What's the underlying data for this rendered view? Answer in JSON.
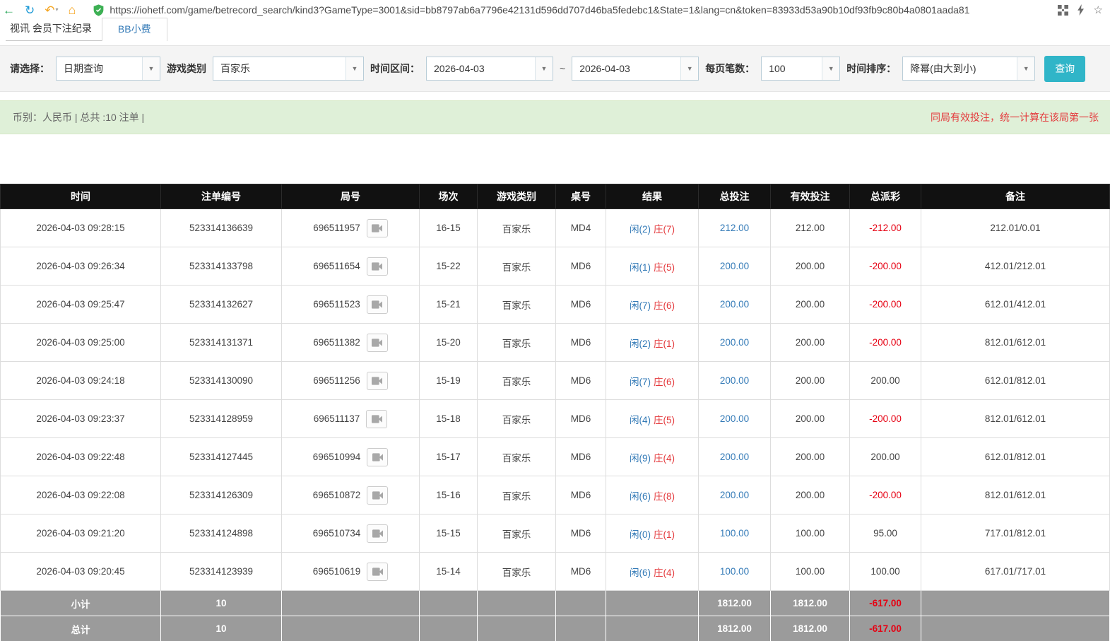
{
  "browser": {
    "url": "https://iohetf.com/game/betrecord_search/kind3?GameType=3001&sid=bb8797ab6a7796e42131d596dd707d46ba5fedebc1&State=1&lang=cn&token=83933d53a90b10df93fb9c80b4a0801aada81"
  },
  "tabs": {
    "records": "视讯 会员下注纪录",
    "bb_tip": "BB小费"
  },
  "filters": {
    "select_label": "请选择：",
    "select_value": "日期查询",
    "game_type_label": "游戏类别",
    "game_type_value": "百家乐",
    "time_range_label": "时间区间：",
    "date_from": "2026-04-03",
    "date_separator": "~",
    "date_to": "2026-04-03",
    "page_size_label": "每页笔数：",
    "page_size_value": "100",
    "sort_label": "时间排序：",
    "sort_value": "降幂(由大到小)",
    "search_button": "查询"
  },
  "info_bar": {
    "summary": "币别：人民币 | 总共 :10 注单 |",
    "notice": "同局有效投注，统一计算在该局第一张"
  },
  "table": {
    "headers": [
      "时间",
      "注单编号",
      "局号",
      "场次",
      "游戏类别",
      "桌号",
      "结果",
      "总投注",
      "有效投注",
      "总派彩",
      "备注"
    ],
    "rows": [
      {
        "time": "2026-04-03 09:28:15",
        "bet_id": "523314136639",
        "round": "696511957",
        "session": "16-15",
        "game": "百家乐",
        "table": "MD4",
        "player": "闲(2)",
        "banker": "庄(7)",
        "total_bet": "212.00",
        "valid_bet": "212.00",
        "payout": "-212.00",
        "remark": "212.01/0.01"
      },
      {
        "time": "2026-04-03 09:26:34",
        "bet_id": "523314133798",
        "round": "696511654",
        "session": "15-22",
        "game": "百家乐",
        "table": "MD6",
        "player": "闲(1)",
        "banker": "庄(5)",
        "total_bet": "200.00",
        "valid_bet": "200.00",
        "payout": "-200.00",
        "remark": "412.01/212.01"
      },
      {
        "time": "2026-04-03 09:25:47",
        "bet_id": "523314132627",
        "round": "696511523",
        "session": "15-21",
        "game": "百家乐",
        "table": "MD6",
        "player": "闲(7)",
        "banker": "庄(6)",
        "total_bet": "200.00",
        "valid_bet": "200.00",
        "payout": "-200.00",
        "remark": "612.01/412.01"
      },
      {
        "time": "2026-04-03 09:25:00",
        "bet_id": "523314131371",
        "round": "696511382",
        "session": "15-20",
        "game": "百家乐",
        "table": "MD6",
        "player": "闲(2)",
        "banker": "庄(1)",
        "total_bet": "200.00",
        "valid_bet": "200.00",
        "payout": "-200.00",
        "remark": "812.01/612.01"
      },
      {
        "time": "2026-04-03 09:24:18",
        "bet_id": "523314130090",
        "round": "696511256",
        "session": "15-19",
        "game": "百家乐",
        "table": "MD6",
        "player": "闲(7)",
        "banker": "庄(6)",
        "total_bet": "200.00",
        "valid_bet": "200.00",
        "payout": "200.00",
        "remark": "612.01/812.01"
      },
      {
        "time": "2026-04-03 09:23:37",
        "bet_id": "523314128959",
        "round": "696511137",
        "session": "15-18",
        "game": "百家乐",
        "table": "MD6",
        "player": "闲(4)",
        "banker": "庄(5)",
        "total_bet": "200.00",
        "valid_bet": "200.00",
        "payout": "-200.00",
        "remark": "812.01/612.01"
      },
      {
        "time": "2026-04-03 09:22:48",
        "bet_id": "523314127445",
        "round": "696510994",
        "session": "15-17",
        "game": "百家乐",
        "table": "MD6",
        "player": "闲(9)",
        "banker": "庄(4)",
        "total_bet": "200.00",
        "valid_bet": "200.00",
        "payout": "200.00",
        "remark": "612.01/812.01"
      },
      {
        "time": "2026-04-03 09:22:08",
        "bet_id": "523314126309",
        "round": "696510872",
        "session": "15-16",
        "game": "百家乐",
        "table": "MD6",
        "player": "闲(6)",
        "banker": "庄(8)",
        "total_bet": "200.00",
        "valid_bet": "200.00",
        "payout": "-200.00",
        "remark": "812.01/612.01"
      },
      {
        "time": "2026-04-03 09:21:20",
        "bet_id": "523314124898",
        "round": "696510734",
        "session": "15-15",
        "game": "百家乐",
        "table": "MD6",
        "player": "闲(0)",
        "banker": "庄(1)",
        "total_bet": "100.00",
        "valid_bet": "100.00",
        "payout": "95.00",
        "remark": "717.01/812.01"
      },
      {
        "time": "2026-04-03 09:20:45",
        "bet_id": "523314123939",
        "round": "696510619",
        "session": "15-14",
        "game": "百家乐",
        "table": "MD6",
        "player": "闲(6)",
        "banker": "庄(4)",
        "total_bet": "100.00",
        "valid_bet": "100.00",
        "payout": "100.00",
        "remark": "617.01/717.01"
      }
    ],
    "footer": [
      {
        "label": "小计",
        "count": "10",
        "total_bet": "1812.00",
        "valid_bet": "1812.00",
        "payout": "-617.00",
        "remark": ""
      },
      {
        "label": "总计",
        "count": "10",
        "total_bet": "1812.00",
        "valid_bet": "1812.00",
        "payout": "-617.00",
        "remark": ""
      }
    ]
  },
  "colors": {
    "accent_teal": "#30b5c8",
    "link_blue": "#337ab7",
    "banker_red": "#e4393c",
    "negative_red": "#e60012",
    "header_black": "#111111",
    "footer_gray": "#9b9b9b",
    "info_green_bg": "#dff0d8"
  }
}
